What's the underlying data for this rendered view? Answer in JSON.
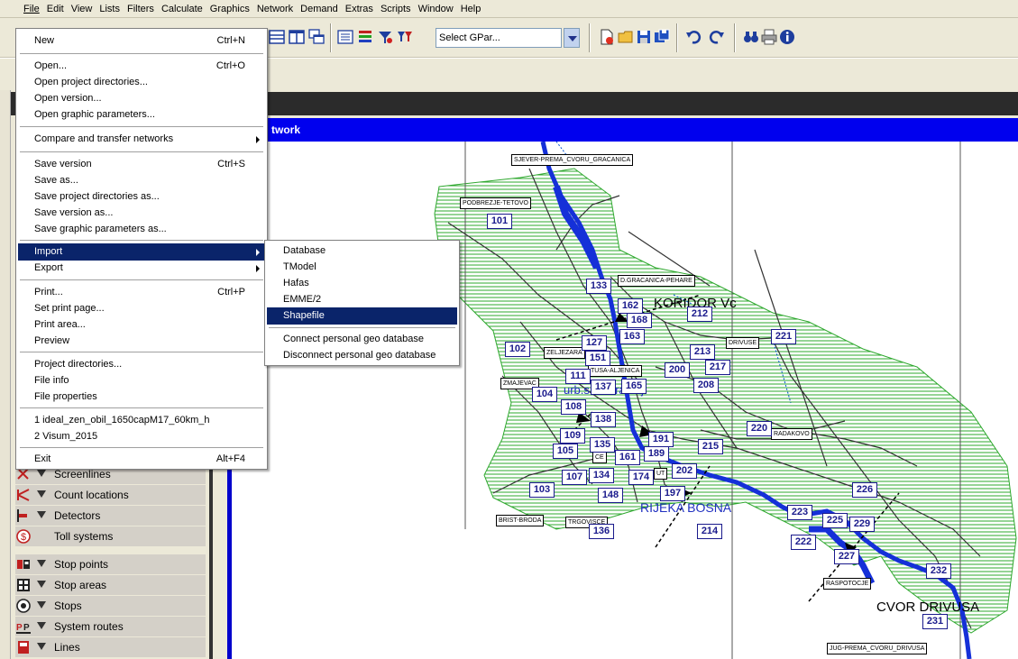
{
  "menubar": [
    "File",
    "Edit",
    "View",
    "Lists",
    "Filters",
    "Calculate",
    "Graphics",
    "Network",
    "Demand",
    "Extras",
    "Scripts",
    "Window",
    "Help"
  ],
  "toolbar": {
    "gpar_select": "Select GPar..."
  },
  "network_window": {
    "title_fragment": "twork"
  },
  "file_menu": {
    "new": {
      "label": "New",
      "shortcut": "Ctrl+N"
    },
    "open": {
      "label": "Open...",
      "shortcut": "Ctrl+O"
    },
    "open_project_dirs": {
      "label": "Open project directories..."
    },
    "open_version": {
      "label": "Open version..."
    },
    "open_graphic_params": {
      "label": "Open graphic parameters..."
    },
    "compare_transfer": {
      "label": "Compare and transfer networks"
    },
    "save_version": {
      "label": "Save version",
      "shortcut": "Ctrl+S"
    },
    "save_as": {
      "label": "Save as..."
    },
    "save_project_dirs_as": {
      "label": "Save project directories as..."
    },
    "save_version_as": {
      "label": "Save version as..."
    },
    "save_graphic_params_as": {
      "label": "Save graphic parameters as..."
    },
    "import": {
      "label": "Import"
    },
    "export": {
      "label": "Export"
    },
    "print": {
      "label": "Print...",
      "shortcut": "Ctrl+P"
    },
    "set_print_page": {
      "label": "Set print page..."
    },
    "print_area": {
      "label": "Print area..."
    },
    "preview": {
      "label": "Preview"
    },
    "project_directories": {
      "label": "Project directories..."
    },
    "file_info": {
      "label": "File info"
    },
    "file_properties": {
      "label": "File properties"
    },
    "recent_1": {
      "label": "1 ideal_zen_obil_1650capM17_60km_h"
    },
    "recent_2": {
      "label": "2 Visum_2015"
    },
    "exit": {
      "label": "Exit",
      "shortcut": "Alt+F4"
    }
  },
  "import_submenu": {
    "database": "Database",
    "tmodel": "TModel",
    "hafas": "Hafas",
    "emme2": "EMME/2",
    "shapefile": "Shapefile",
    "connect_geo_db": "Connect personal geo database",
    "disconnect_geo_db": "Disconnect personal geo database"
  },
  "left_panel": {
    "items": [
      "Screenlines",
      "Count locations",
      "Detectors",
      "Toll systems",
      "Stop points",
      "Stop areas",
      "Stops",
      "System routes",
      "Lines"
    ]
  },
  "map": {
    "zones": [
      "101",
      "102",
      "103",
      "104",
      "105",
      "107",
      "108",
      "109",
      "111",
      "127",
      "133",
      "134",
      "135",
      "136",
      "137",
      "138",
      "148",
      "151",
      "161",
      "162",
      "163",
      "165",
      "168",
      "174",
      "189",
      "191",
      "197",
      "200",
      "202",
      "208",
      "212",
      "213",
      "214",
      "215",
      "217",
      "220",
      "221",
      "222",
      "223",
      "225",
      "226",
      "227",
      "229",
      "231",
      "232"
    ],
    "labels": {
      "sjever": "SJEVER-PREMA_CVORU_GRACANICA",
      "podbrezje": "PODBREZJE-TETOVO",
      "gracanica": "D.GRACANICA-PEHARE",
      "zeljezara": "ZELJEZARA",
      "zmajevac": "ZMAJEVAC",
      "tuzla": "TUSA-ALJENICA",
      "brist": "BRIST-BRODA",
      "trgovisce": "TRGOVISCE",
      "radakovo": "RADAKOVO",
      "raspotocje": "RASPOTOCJE",
      "jug": "JUG-PREMA_CVORU_DRIVUSA",
      "ce": "CE",
      "drivusa_top": "DRIVUSE",
      "ut": "UT"
    },
    "big_labels": {
      "koridor": "KORIDOR Vc",
      "rijeka": "RIJEKA BOSNA",
      "cvor": "CVOR DRIVUSA",
      "urb": "urb.s.centralnoj"
    }
  },
  "colors": {
    "highlight": "#0a246a",
    "title_blue": "#0000ee",
    "river": "#1530d8",
    "zone_fill": "#2ea82e",
    "zone_box": "#1a1a8c"
  }
}
